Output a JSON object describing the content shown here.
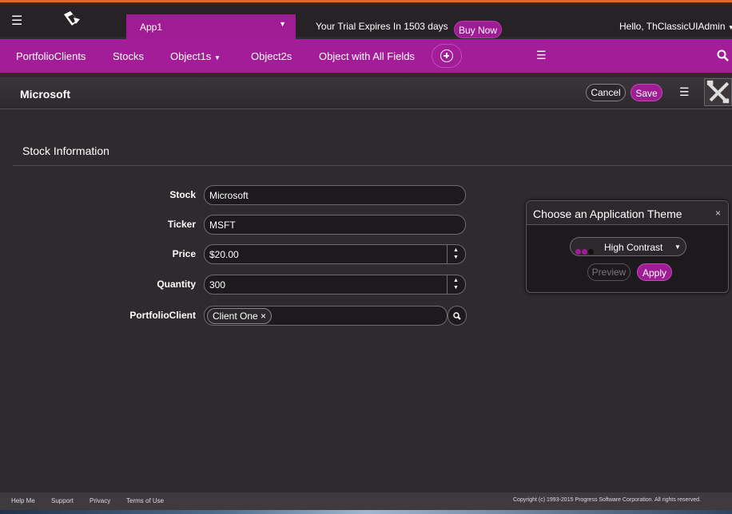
{
  "topbar": {
    "app_name": "App1",
    "trial_text": "Your Trial Expires In 1503 days",
    "buy_label": "Buy Now",
    "greeting": "Hello, ThClassicUIAdmin"
  },
  "nav": {
    "items": [
      "PortfolioClients",
      "Stocks",
      "Object1s",
      "Object2s",
      "Object with All Fields"
    ]
  },
  "record": {
    "title": "Microsoft",
    "cancel_label": "Cancel",
    "save_label": "Save"
  },
  "section": {
    "title": "Stock Information"
  },
  "form": {
    "stock_label": "Stock",
    "stock_value": "Microsoft",
    "ticker_label": "Ticker",
    "ticker_value": "MSFT",
    "price_label": "Price",
    "price_value": "$20.00",
    "quantity_label": "Quantity",
    "quantity_value": "300",
    "client_label": "PortfolioClient",
    "client_value": "Client One ×"
  },
  "theme_popup": {
    "title": "Choose an Application Theme",
    "close": "×",
    "selected_theme": "High Contrast",
    "preview_label": "Preview",
    "apply_label": "Apply",
    "swatch_colors": [
      "#a01c94",
      "#a01c94",
      "#111111"
    ]
  },
  "footer": {
    "links": [
      "Help Me",
      "Support",
      "Privacy",
      "Terms of Use"
    ],
    "copyright": "Copyright (c) 1993-2015 Progress Software Corporation. All rights reserved."
  },
  "icons": [
    "hamburger-icon",
    "logo-icon",
    "chevron-down-icon",
    "plus-circle-icon",
    "search-icon",
    "wrench-icon",
    "close-icon"
  ],
  "colors": {
    "accent": "#a01c94",
    "background": "#2e2a2d",
    "topbar": "#262226"
  }
}
